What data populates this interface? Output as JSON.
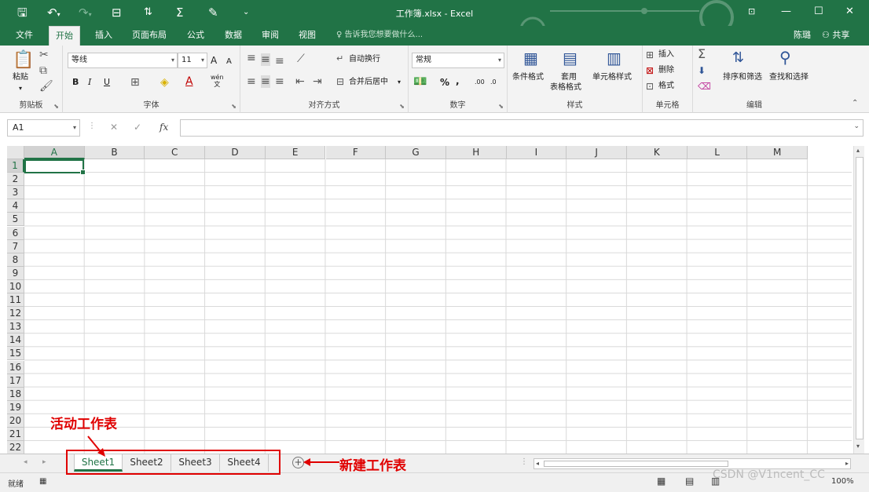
{
  "window": {
    "title": "工作簿.xlsx - Excel",
    "quick_access": [
      "save-icon",
      "undo-icon",
      "redo-icon",
      "open-icon",
      "sort-icon",
      "sum-icon",
      "format-painter-icon",
      "customize-icon"
    ],
    "controls": {
      "ribbon_display": "⊡",
      "minimize": "—",
      "maximize": "☐",
      "close": "✕"
    }
  },
  "ribbon_tabs": {
    "file": "文件",
    "items": [
      "开始",
      "插入",
      "页面布局",
      "公式",
      "数据",
      "审阅",
      "视图"
    ],
    "active": "开始",
    "tell_me": "告诉我您想要做什么...",
    "user": "陈璐",
    "share": "共享"
  },
  "ribbon": {
    "clipboard": {
      "label": "剪贴板",
      "paste": "粘贴"
    },
    "font": {
      "label": "字体",
      "font_name": "等线",
      "font_size": "11",
      "bold": "B",
      "italic": "I",
      "underline": "U",
      "grow": "A",
      "shrink": "A",
      "phonetic_top": "wén",
      "phonetic_bottom": "文"
    },
    "alignment": {
      "label": "对齐方式",
      "wrap_text": "自动换行",
      "merge_center": "合并后居中"
    },
    "number": {
      "label": "数字",
      "format": "常规",
      "percent": "%",
      "comma": ",",
      "inc_decimal": ".00",
      "dec_decimal": ".0"
    },
    "styles": {
      "label": "样式",
      "conditional": "条件格式",
      "table_top": "套用",
      "table_bottom": "表格格式",
      "cell_styles": "单元格样式"
    },
    "cells": {
      "label": "单元格",
      "insert": "插入",
      "delete": "删除",
      "format": "格式"
    },
    "editing": {
      "label": "编辑",
      "sort_filter": "排序和筛选",
      "find_select": "查找和选择"
    }
  },
  "formula_bar": {
    "name_box": "A1",
    "fx": "fx",
    "cancel": "✕",
    "enter": "✓",
    "value": ""
  },
  "grid": {
    "columns": [
      "A",
      "B",
      "C",
      "D",
      "E",
      "F",
      "G",
      "H",
      "I",
      "J",
      "K",
      "L",
      "M"
    ],
    "rows": [
      "1",
      "2",
      "3",
      "4",
      "5",
      "6",
      "7",
      "8",
      "9",
      "10",
      "11",
      "12",
      "13",
      "14",
      "15",
      "16",
      "17",
      "18",
      "19",
      "20",
      "21",
      "22"
    ],
    "active_cell": "A1"
  },
  "sheets": {
    "tabs": [
      "Sheet1",
      "Sheet2",
      "Sheet3",
      "Sheet4"
    ],
    "active": "Sheet1"
  },
  "status": {
    "ready": "就绪",
    "zoom": "100%"
  },
  "annotations": {
    "active_sheet": "活动工作表",
    "new_sheet": "新建工作表"
  },
  "watermark": "CSDN @V1ncent_CC",
  "colors": {
    "accent": "#217346",
    "annotation": "#e00000"
  }
}
